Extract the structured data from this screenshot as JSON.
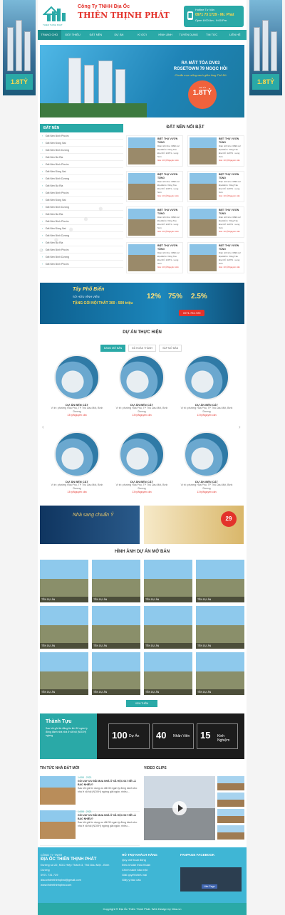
{
  "side_ad_price": "1.8TỶ",
  "header": {
    "brand_top": "Công Ty TNHH Địa Ốc",
    "brand_main": "THIÊN THỊNH PHÁT",
    "logo_sub": "THIEN THINH PHAT",
    "hotline_label": "Hotline Tư Vấn",
    "hotline_number": "0971 73 1729 - Mr. Phát",
    "hours": "Open 8:00 Am - 9:00 Pm"
  },
  "nav": [
    "TRANG CHỦ",
    "GIỚI THIỆU",
    "ĐẤT NỀN",
    "DỰ ÁN",
    "KÍ GỬI",
    "HÌNH ẢNH",
    "TUYỂN DỤNG",
    "TIN TỨC",
    "LIÊN HỆ"
  ],
  "banner": {
    "line1": "RA MẮT TÒA DV03",
    "line2": "ROSETOWN 79 NGỌC HỒI",
    "tagline": "Chuẩn mực sống xanh giữa lòng Thủ Đô",
    "price_label": "CHỈ TỪ",
    "price": "1.8TỶ"
  },
  "sidebar": {
    "title": "ĐẤT NỀN",
    "items": [
      "Đất Nền Bình Phước",
      "Đất Nền Đồng Nai",
      "Đất Nền Bình Dương",
      "Đất Nền Bà Rịa",
      "Đất Nền Bình Phước",
      "Đất Nền Đồng Nai",
      "Đất Nền Bình Dương",
      "Đất Nền Bà Rịa",
      "Đất Nền Bình Phước",
      "Đất Nền Đồng Nai",
      "Đất Nền Bình Dương",
      "Đất Nền Bà Rịa",
      "Đất Nền Bình Phước",
      "Đất Nền Đồng Nai",
      "Đất Nền Bình Dương",
      "Đất Nền Bà Rịa",
      "Đất Nền Bình Phước",
      "Đất Nền Bình Dương",
      "Đất Nền Bình Phước"
    ]
  },
  "featured": {
    "title": "ĐẤT NỀN NỔI BẬT",
    "items": [
      {
        "title": "BIỆT THỰ VƯỜN TÙNG",
        "area": "Diện tích khu: 3090 m2",
        "place": "Địa Điểm: Vũng Tàu",
        "road": "Đia Chỉ: 120T1 - Long Sơn",
        "price": "Giá: 13 tỷ/Nguyên căn"
      },
      {
        "title": "BIỆT THỰ VƯỜN TÙNG",
        "area": "Diện tích khu: 3090 m2",
        "place": "Địa Điểm: Vũng Tàu",
        "road": "Đia Chỉ: 120T1 - Long Sơn",
        "price": "Giá: 13 tỷ/Nguyên căn"
      },
      {
        "title": "BIỆT THỰ VƯỜN TÙNG",
        "area": "Diện tích khu: 3090 m2",
        "place": "Địa Điểm: Vũng Tàu",
        "road": "Đia Chỉ: 120T1 - Long Sơn",
        "price": "Giá: 13 tỷ/Nguyên căn"
      },
      {
        "title": "BIỆT THỰ VƯỜN TÙNG",
        "area": "Diện tích khu: 3090 m2",
        "place": "Địa Điểm: Vũng Tàu",
        "road": "Đia Chỉ: 120T1 - Long Sơn",
        "price": "Giá: 13 tỷ/Nguyên căn"
      },
      {
        "title": "BIỆT THỰ VƯỜN TÙNG",
        "area": "Diện tích khu: 3090 m2",
        "place": "Địa Điểm: Vũng Tàu",
        "road": "Đia Chỉ: 120T1 - Long Sơn",
        "price": "Giá: 13 tỷ/Nguyên căn"
      },
      {
        "title": "BIỆT THỰ VƯỜN TÙNG",
        "area": "Diện tích khu: 3090 m2",
        "place": "Địa Điểm: Vũng Tàu",
        "road": "Đia Chỉ: 120T1 - Long Sơn",
        "price": "Giá: 13 tỷ/Nguyên căn"
      },
      {
        "title": "BIỆT THỰ VƯỜN TÙNG",
        "area": "Diện tích khu: 3090 m2",
        "place": "Địa Điểm: Vũng Tàu",
        "road": "Đia Chỉ: 120T1 - Long Sơn",
        "price": "Giá: 13 tỷ/Nguyên căn"
      },
      {
        "title": "BIỆT THỰ VƯỜN TÙNG",
        "area": "Diện tích khu: 3090 m2",
        "place": "Địa Điểm: Vũng Tàu",
        "road": "Đia Chỉ: 120T1 - Long Sơn",
        "price": "Giá: 13 tỷ/Nguyên căn"
      }
    ]
  },
  "ad2": {
    "title": "Tây Phố Biển",
    "subtitle": "SỞ HỮU VĨNH VIỄN",
    "prize": "TẶNG GÓI NỘI THẤT 300 - 500 triệu",
    "pct1": "12%",
    "pct2": "75%",
    "pct3": "2.5%",
    "phone": "0971.731.729"
  },
  "projects": {
    "title": "DỰ ÁN THỰC HIỆN",
    "tabs": [
      "ĐANG MỞ BÁN",
      "ĐÃ HOÀN THÀNH",
      "SẮP MỞ BÁN"
    ],
    "items": [
      {
        "name": "DỰ ÁN BẾN CÁT",
        "addr": "Vị trí: phường Hòa Phú, TP Thủ Dầu Một, Bình Dương",
        "price": "13 tỷ/Nguyên căn"
      },
      {
        "name": "DỰ ÁN BẾN CÁT",
        "addr": "Vị trí: phường Hòa Phú, TP Thủ Dầu Một, Bình Dương",
        "price": "13 tỷ/Nguyên căn"
      },
      {
        "name": "DỰ ÁN BẾN CÁT",
        "addr": "Vị trí: phường Hòa Phú, TP Thủ Dầu Một, Bình Dương",
        "price": "13 tỷ/Nguyên căn"
      },
      {
        "name": "DỰ ÁN BẾN CÁT",
        "addr": "Vị trí: phường Hòa Phú, TP Thủ Dầu Một, Bình Dương",
        "price": "13 tỷ/Nguyên căn"
      },
      {
        "name": "DỰ ÁN BẾN CÁT",
        "addr": "Vị trí: phường Hòa Phú, TP Thủ Dầu Một, Bình Dương",
        "price": "13 tỷ/Nguyên căn"
      },
      {
        "name": "DỰ ÁN BẾN CÁT",
        "addr": "Vị trí: phường Hòa Phú, TP Thủ Dầu Một, Bình Dương",
        "price": "13 tỷ/Nguyên căn"
      }
    ]
  },
  "ads3": {
    "left": "Nhà sang chuẩn Ý",
    "right": "29"
  },
  "gallery": {
    "title": "HÌNH ẢNH DỰ ÁN MỞ BÁN",
    "label": "TÊN DỰ ÁN",
    "more": "XEM THÊM"
  },
  "achieve": {
    "title": "Thành Tựu",
    "desc": "Sau khi gửi tin đăng tin lên 30 ngàn tỷ đồng đánh nhà nhà ở xã hội (NOXH) ngừng",
    "stats": [
      {
        "num": "100",
        "label": "Dự Án"
      },
      {
        "num": "40",
        "label": "Nhân Viên"
      },
      {
        "num": "15",
        "label": "Kinh Nghiệm"
      }
    ]
  },
  "news": {
    "title": "TIN TỨC NHÀ ĐẤT MỚI",
    "video_title": "VIDEO CLIPS",
    "items": [
      {
        "date": "14/08 - 2021",
        "title": "GÓI VAY ƯU ĐÃI MUA NHÀ Ở XÃ HỘI 2017 SẼ LÀ BAO NHIÊU?",
        "desc": "Sau khi gói tín dụng ưu đãi 30 ngàn tỷ đồng dành cho nhà ở xã hội (NOXH) ngừng giải ngân, nhiều..."
      },
      {
        "date": "14/08 - 2021",
        "title": "GÓI VAY ƯU ĐÃI MUA NHÀ Ở XÃ HỘI 2017 SẼ LÀ BAO NHIÊU?",
        "desc": "Sau khi gói tín dụng ưu đãi 30 ngàn tỷ đồng dành cho nhà ở xã hội (NOXH) ngừng giải ngân, nhiều..."
      }
    ]
  },
  "footer": {
    "company_label": "CÔNG TY TNHH",
    "company": "ĐỊA ỐC THIÊN THỊNH PHÁT",
    "addr": "Đường số 22, KDC Hiệp Thành 3, Thủ Dầu Một - Bình Dương",
    "phone": "0971 731 729",
    "email": "diaocthienthinhphat@gmail.com",
    "web": "www.thienthinhphat.com",
    "support_title": "HỖ TRỢ KHÁCH HÀNG",
    "support_items": [
      "Quy chế hoạt động",
      "Điều khoản thỏa thuận",
      "Chính sách bảo mật",
      "Giải quyết khiếu nại",
      "Giấy ý bảo cấu"
    ],
    "fanpage_title": "FANPAGE FACEBOOK",
    "fb_like": "Like Page",
    "copyright": "Copyright © Địa Ốc Thiên Thịnh Phát. Web Design by Nina.vn"
  },
  "colors": {
    "accent": "#2aa9a7",
    "brand_red": "#e3322b",
    "price_yellow": "#ffd84a"
  }
}
